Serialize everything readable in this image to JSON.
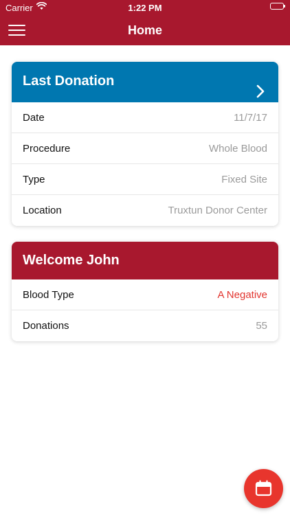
{
  "status_bar": {
    "carrier": "Carrier",
    "time": "1:22 PM"
  },
  "nav": {
    "title": "Home",
    "menu_icon": "hamburger-menu-icon"
  },
  "last_donation": {
    "title": "Last Donation",
    "header_color": "#0077b0",
    "rows": [
      {
        "label": "Date",
        "value": "11/7/17"
      },
      {
        "label": "Procedure",
        "value": "Whole Blood"
      },
      {
        "label": "Type",
        "value": "Fixed Site"
      },
      {
        "label": "Location",
        "value": "Truxtun Donor Center"
      }
    ]
  },
  "welcome": {
    "title": "Welcome John",
    "header_color": "#a8182e",
    "rows": [
      {
        "label": "Blood Type",
        "value": "A Negative"
      },
      {
        "label": "Donations",
        "value": "55"
      }
    ]
  },
  "fab": {
    "icon": "calendar-icon",
    "color": "#e8352d"
  },
  "colors": {
    "brand_red": "#a8182e",
    "blue": "#0077b0",
    "accent_red": "#e2352f",
    "muted_text": "#9a9a9a"
  }
}
